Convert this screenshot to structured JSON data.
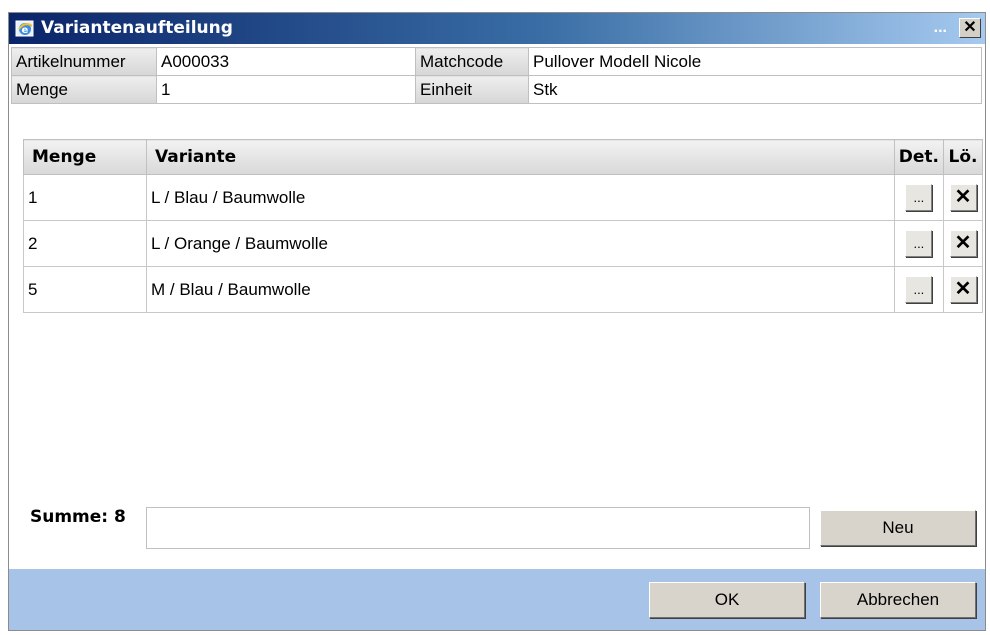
{
  "window": {
    "title": "Variantenaufteilung",
    "dots": "...",
    "close_glyph": "✕"
  },
  "info": {
    "artikelnummer_label": "Artikelnummer",
    "artikelnummer_value": "A000033",
    "matchcode_label": "Matchcode",
    "matchcode_value": "Pullover Modell Nicole",
    "menge_label": "Menge",
    "menge_value": "1",
    "einheit_label": "Einheit",
    "einheit_value": "Stk"
  },
  "grid": {
    "headers": {
      "menge": "Menge",
      "variante": "Variante",
      "det": "Det.",
      "loe": "Lö."
    },
    "rows": [
      {
        "menge": "1",
        "variante": "L / Blau / Baumwolle"
      },
      {
        "menge": "2",
        "variante": "L / Orange / Baumwolle"
      },
      {
        "menge": "5",
        "variante": "M / Blau / Baumwolle"
      }
    ],
    "det_glyph": "...",
    "del_glyph": "✕"
  },
  "summary": {
    "label": "Summe: 8",
    "field_value": ""
  },
  "buttons": {
    "neu": "Neu",
    "ok": "OK",
    "abbrechen": "Abbrechen"
  },
  "colors": {
    "titlebar_start": "#0a246a",
    "titlebar_end": "#a6caf0",
    "footer": "#a7c3e8"
  },
  "icons": {
    "title_icon": "ie-window-icon"
  }
}
